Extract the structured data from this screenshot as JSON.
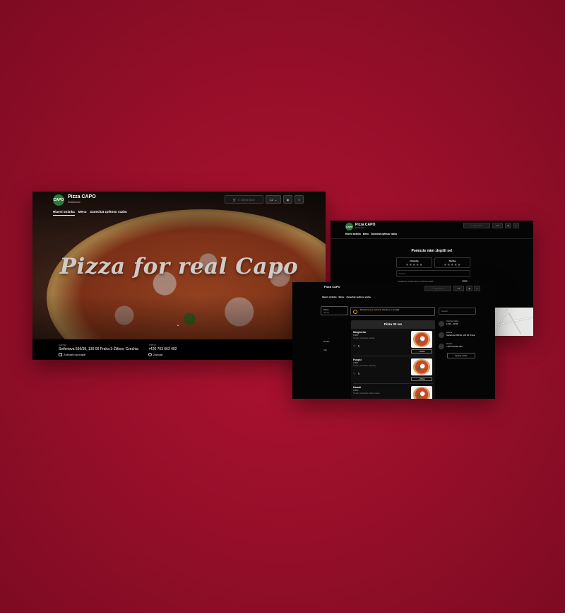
{
  "brand": {
    "name": "Pizza CAPO",
    "subtitle": "Restaurace",
    "logo_text": "CAPO"
  },
  "nav": {
    "tabs": [
      "Hlavní stránka",
      "Menu",
      "Zanechat zpětnou vazbu"
    ]
  },
  "toolbar": {
    "order_label": "K objednávce",
    "language": "CZ",
    "user_icon": "user-icon",
    "menu_icon": "hamburger-icon"
  },
  "home": {
    "headline": "Pizza for real Capo",
    "address_label": "Adresa",
    "address": "Seifertova 566/39, 130 00 Praha 3-Žižkov, Czechia",
    "map_link": "Zobrazit na mapě",
    "phone_label": "Telefon",
    "phone": "+420 703 662 402",
    "call_link": "Zavolat"
  },
  "feedback": {
    "heading": "Pomozte nám zlepšit se!",
    "rating_1": "Obsluha",
    "rating_2": "Služba",
    "stars": "★★★★★",
    "textarea_placeholder": "Napište",
    "consent": "Souhlas se zpracováním osobních údajů"
  },
  "menu_page": {
    "category_select": "Pizza",
    "category_select_sub": "32 cm",
    "side_a": "Drinks",
    "side_b": "Info",
    "notice_warning": "Restaurace je zavřená.",
    "notice_text": "Otevře se v pondělí.",
    "search_placeholder": "Hledat",
    "section_title": "Pizza 32 cm",
    "add_button": "+ Přidat",
    "items": [
      {
        "name": "Margherita",
        "code": "199Kč",
        "desc": "Tomato, mozzarella, bazalka"
      },
      {
        "name": "Funghi",
        "code": "219Kč",
        "desc": "Tomato, mozzarella, žampiony"
      },
      {
        "name": "Hawaii",
        "code": "229Kč",
        "desc": "Tomato, mozzarella, šunka, ananas"
      }
    ],
    "info": {
      "hours_label": "Otevírací doba",
      "hours": "11:00 - 22:00",
      "address_label": "Adresa",
      "address": "Seifertova 566/39, 130 00 Praha",
      "phone_label": "Telefon",
      "phone": "+420 703 662 402",
      "feedback_button": "Zpětná vazba"
    }
  },
  "colors": {
    "background": "#9a0f2b",
    "logo_green": "#2d7a3a",
    "warning": "#f0a020"
  }
}
